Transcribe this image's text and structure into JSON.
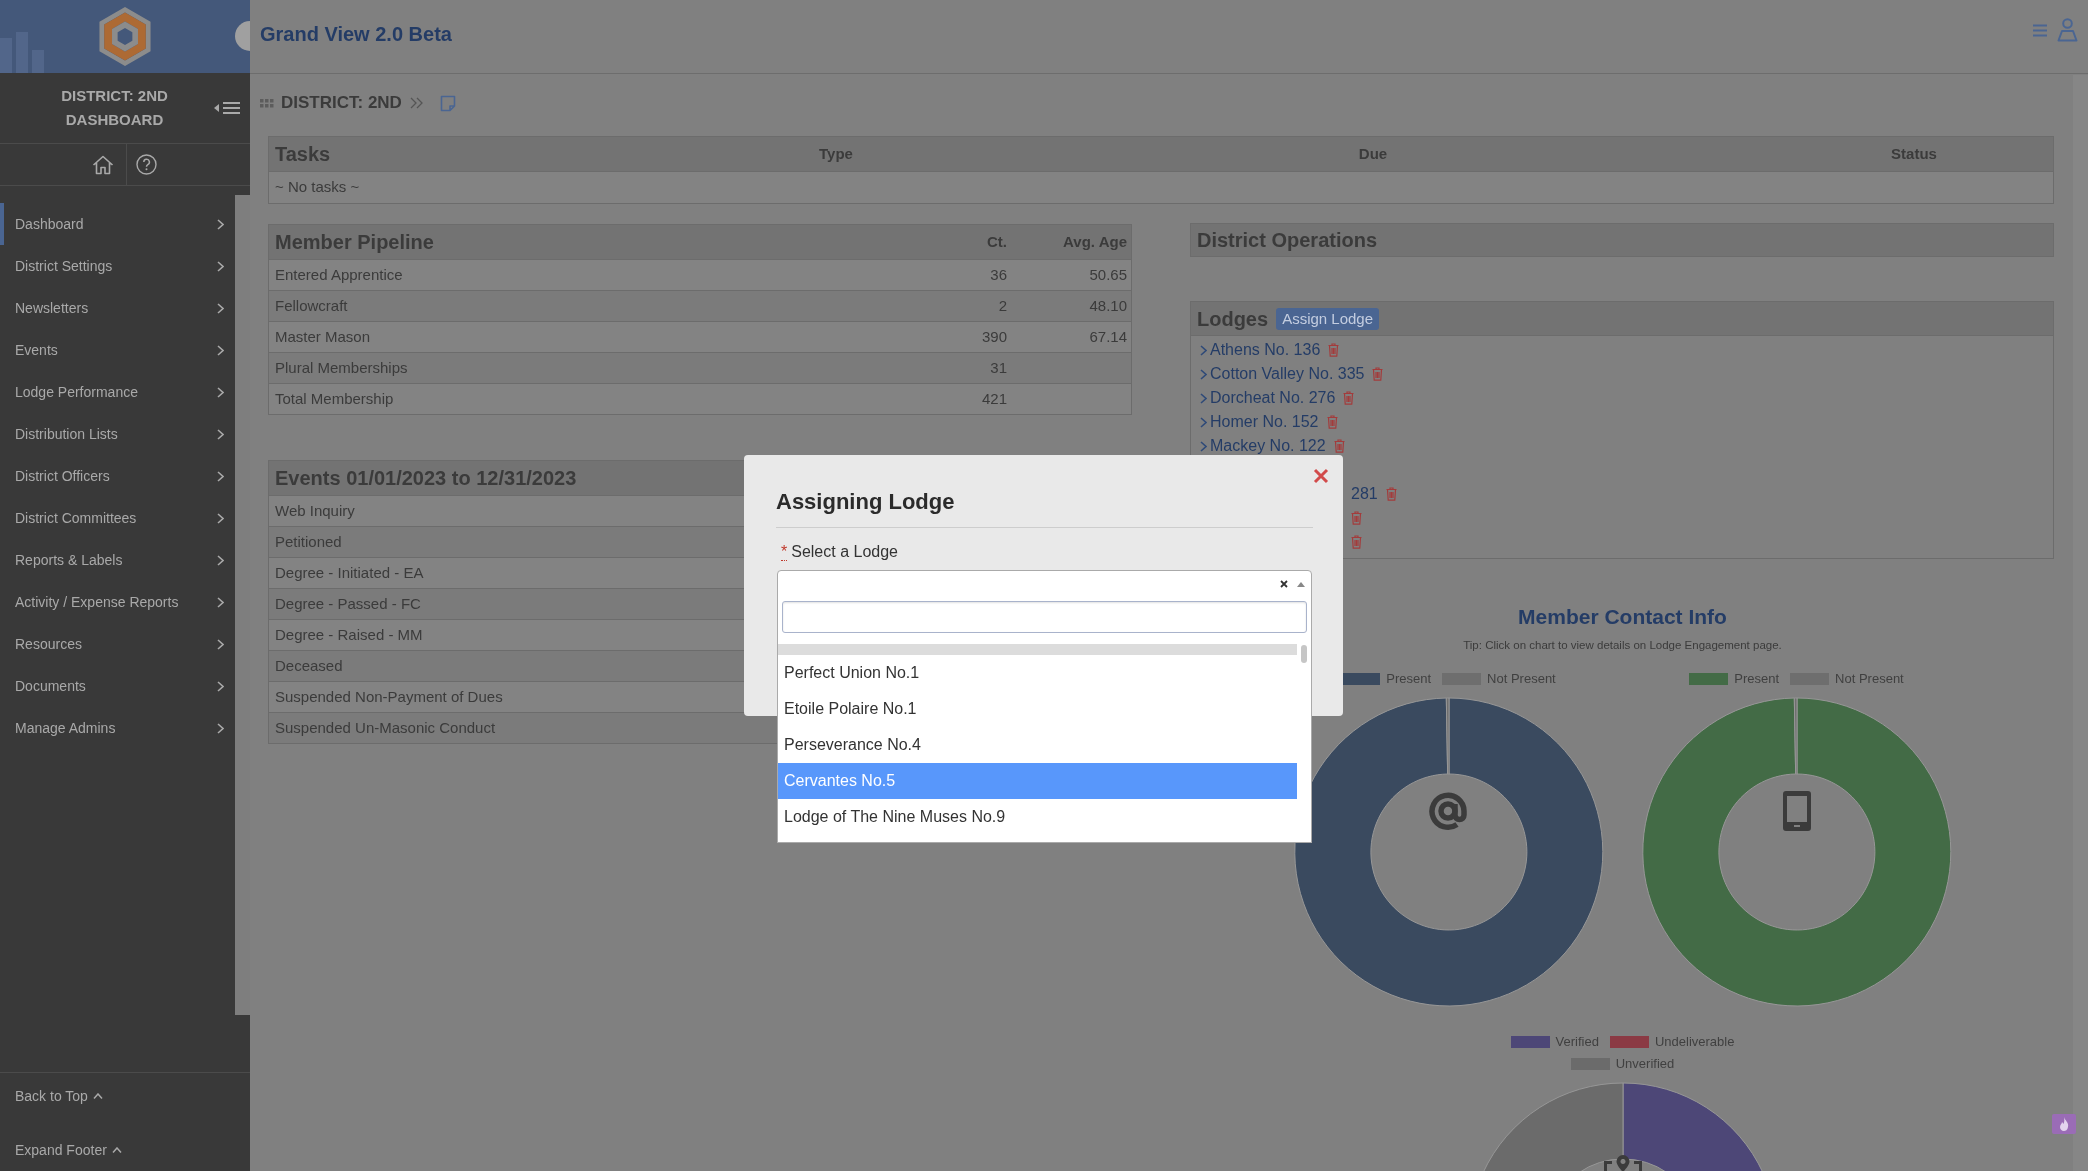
{
  "header": {
    "title": "Grand View 2.0 Beta"
  },
  "sidebar": {
    "title": "DISTRICT: 2ND DASHBOARD",
    "items": [
      {
        "label": "Dashboard",
        "selected": true
      },
      {
        "label": "District Settings",
        "selected": false
      },
      {
        "label": "Newsletters",
        "selected": false
      },
      {
        "label": "Events",
        "selected": false
      },
      {
        "label": "Lodge Performance",
        "selected": false
      },
      {
        "label": "Distribution Lists",
        "selected": false
      },
      {
        "label": "District Officers",
        "selected": false
      },
      {
        "label": "District Committees",
        "selected": false
      },
      {
        "label": "Reports & Labels",
        "selected": false
      },
      {
        "label": "Activity / Expense Reports",
        "selected": false
      },
      {
        "label": "Resources",
        "selected": false
      },
      {
        "label": "Documents",
        "selected": false
      },
      {
        "label": "Manage Admins",
        "selected": false
      }
    ],
    "footer_links": [
      "Back to Top",
      "Expand Footer"
    ]
  },
  "breadcrumb": {
    "title": "DISTRICT: 2ND"
  },
  "tasks": {
    "columns": [
      "Tasks",
      "Type",
      "Due",
      "Status"
    ],
    "empty_text": "~ No tasks ~"
  },
  "member_pipeline": {
    "title": "Member Pipeline",
    "columns": [
      "Ct.",
      "Avg. Age"
    ],
    "rows": [
      {
        "label": "Entered Apprentice",
        "values": [
          "36",
          "50.65"
        ]
      },
      {
        "label": "Fellowcraft",
        "values": [
          "2",
          "48.10"
        ]
      },
      {
        "label": "Master Mason",
        "values": [
          "390",
          "67.14"
        ]
      },
      {
        "label": "Plural Memberships",
        "values": [
          "31"
        ]
      },
      {
        "label": "Total Membership",
        "values": [
          "421"
        ]
      }
    ]
  },
  "events": {
    "title": "Events 01/01/2023 to 12/31/2023",
    "rows": [
      {
        "label": "Web Inquiry"
      },
      {
        "label": "Petitioned"
      },
      {
        "label": "Degree - Initiated - EA"
      },
      {
        "label": "Degree - Passed - FC"
      },
      {
        "label": "Degree - Raised - MM"
      },
      {
        "label": "Deceased"
      },
      {
        "label": "Suspended Non-Payment of Dues"
      },
      {
        "label": "Suspended Un-Masonic Conduct"
      }
    ]
  },
  "district_operations": {
    "title": "District Operations"
  },
  "lodges": {
    "title": "Lodges",
    "action": "Assign Lodge",
    "items": [
      {
        "kind": "link",
        "label": "Athens No. 136"
      },
      {
        "kind": "link",
        "label": "Cotton Valley No. 335"
      },
      {
        "kind": "link",
        "label": "Dorcheat No. 276"
      },
      {
        "kind": "link",
        "label": "Homer No. 152"
      },
      {
        "kind": "link",
        "label": "Mackey No. 122"
      },
      {
        "kind": "fragment",
        "label": "281"
      },
      {
        "kind": "fragment"
      },
      {
        "kind": "fragment"
      }
    ]
  },
  "member_contact": {
    "title": "Member Contact Info",
    "tip": "Tip: Click on chart to view details on Lodge Engagement page.",
    "charts": [
      {
        "legend": [
          {
            "label": "Present",
            "color": "#3a4a5f"
          },
          {
            "label": "Not Present",
            "color": "#6e6e6e"
          }
        ]
      },
      {
        "legend": [
          {
            "label": "Present",
            "color": "#436b46"
          },
          {
            "label": "Not Present",
            "color": "#6e6e6e"
          }
        ]
      },
      {
        "legend": [
          {
            "label": "Verified",
            "color": "#4d4777"
          },
          {
            "label": "Undeliverable",
            "color": "#8b3a44"
          },
          {
            "label": "Unverified",
            "color": "#6b6b6b"
          }
        ]
      }
    ]
  },
  "modal": {
    "title": "Assigning Lodge",
    "required_mark": "*",
    "label": "Select a Lodge",
    "options": [
      {
        "label": "Perfect Union No.1",
        "selected": false
      },
      {
        "label": "Etoile Polaire No.1",
        "selected": false
      },
      {
        "label": "Perseverance No.4",
        "selected": false
      },
      {
        "label": "Cervantes No.5",
        "selected": true
      },
      {
        "label": "Lodge of The Nine Muses No.9",
        "selected": false
      }
    ]
  }
}
